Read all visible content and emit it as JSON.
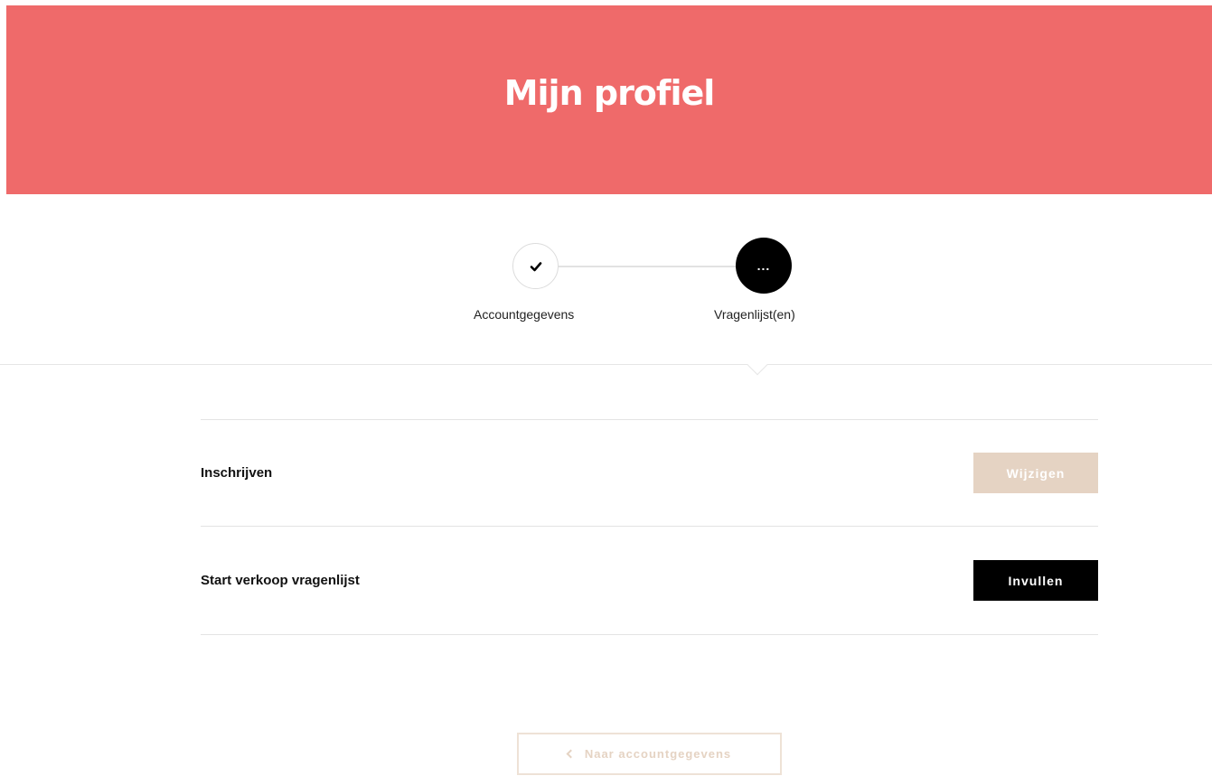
{
  "header": {
    "title": "Mijn profiel"
  },
  "stepper": {
    "steps": [
      {
        "label": "Accountgegevens",
        "status": "done",
        "icon": "check-icon"
      },
      {
        "label": "Vragenlijst(en)",
        "status": "active",
        "icon_text": "..."
      }
    ]
  },
  "questionnaires": [
    {
      "title": "Inschrijven",
      "button_label": "Wijzigen",
      "button_state": "disabled"
    },
    {
      "title": "Start verkoop vragenlijst",
      "button_label": "Invullen",
      "button_state": "enabled"
    }
  ],
  "footer": {
    "back_label": "Naar accountgegevens",
    "back_icon": "chevron-left-icon"
  },
  "colors": {
    "header_bg": "#ef6a6a",
    "active_step": "#000000",
    "disabled_button": "#e5d3c3",
    "primary_button": "#000000"
  }
}
